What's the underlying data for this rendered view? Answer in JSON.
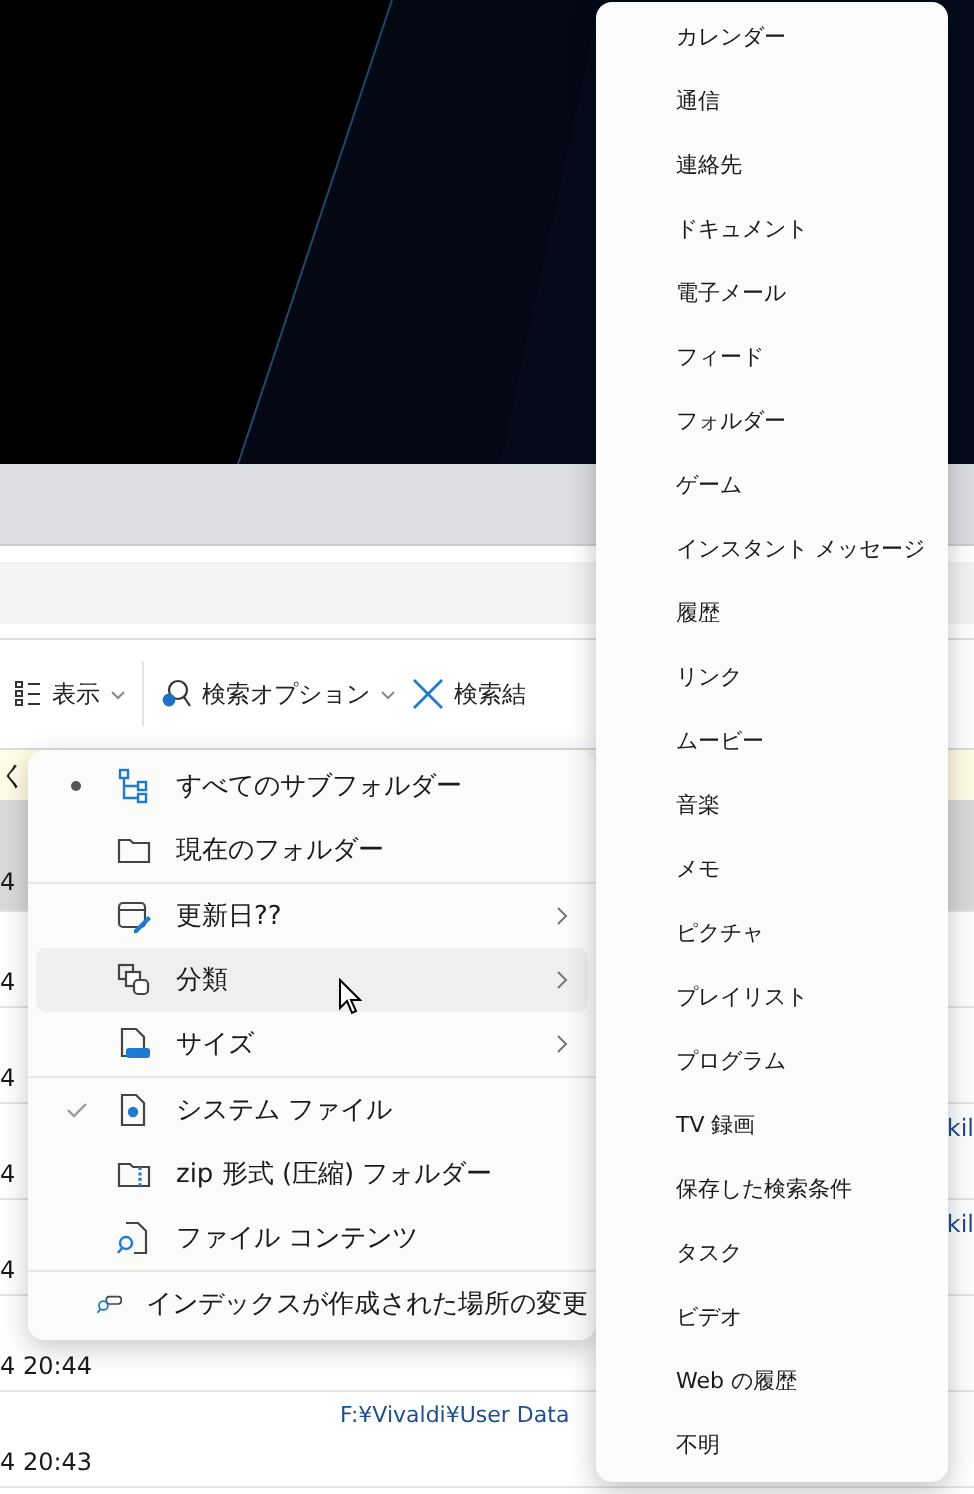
{
  "toolbar": {
    "buttons": [
      {
        "label": "表示",
        "kind": "view"
      },
      {
        "label": "検索オプション",
        "kind": "options"
      },
      {
        "label": "検索結",
        "kind": "close"
      }
    ]
  },
  "info_bar": {
    "text": "く"
  },
  "rows": [
    {
      "date": "4",
      "selected": true
    },
    {
      "date": "4",
      "selected": false
    },
    {
      "date": "4",
      "selected": false
    },
    {
      "date": "4",
      "column_3": "kil",
      "selected": false
    },
    {
      "date": "4",
      "column_3": "kil",
      "selected": false
    },
    {
      "date": "4 20:44",
      "selected": false
    },
    {
      "date": "4 20:43",
      "column_2": "F:¥Vivaldi¥User Data",
      "selected": false
    }
  ],
  "search_options_menu": {
    "sections": [
      [
        {
          "label": "すべてのサブフォルダー",
          "kind": "radio",
          "selected": true
        },
        {
          "label": "現在のフォルダー",
          "kind": "radio",
          "selected": false
        }
      ],
      [
        {
          "label": "更新日??",
          "kind": "submenu",
          "hovered": false
        },
        {
          "label": "分類",
          "kind": "submenu",
          "hovered": true
        },
        {
          "label": "サイズ",
          "kind": "submenu",
          "hovered": false
        }
      ],
      [
        {
          "label": "システム ファイル",
          "kind": "check",
          "checked": true
        },
        {
          "label": "zip 形式 (圧縮) フォルダー",
          "kind": "check",
          "checked": false
        },
        {
          "label": "ファイル コンテンツ",
          "kind": "check",
          "checked": false
        }
      ],
      [
        {
          "label": "インデックスが作成された場所の変更",
          "kind": "action"
        }
      ]
    ]
  },
  "kind_submenu": {
    "items": [
      "カレンダー",
      "通信",
      "連絡先",
      "ドキュメント",
      "電子メール",
      "フィード",
      "フォルダー",
      "ゲーム",
      "インスタント メッセージ",
      "履歴",
      "リンク",
      "ムービー",
      "音楽",
      "メモ",
      "ピクチャ",
      "プレイリスト",
      "プログラム",
      "TV 録画",
      "保存した検索条件",
      "タスク",
      "ビデオ",
      "Web の履歴",
      "不明"
    ]
  }
}
